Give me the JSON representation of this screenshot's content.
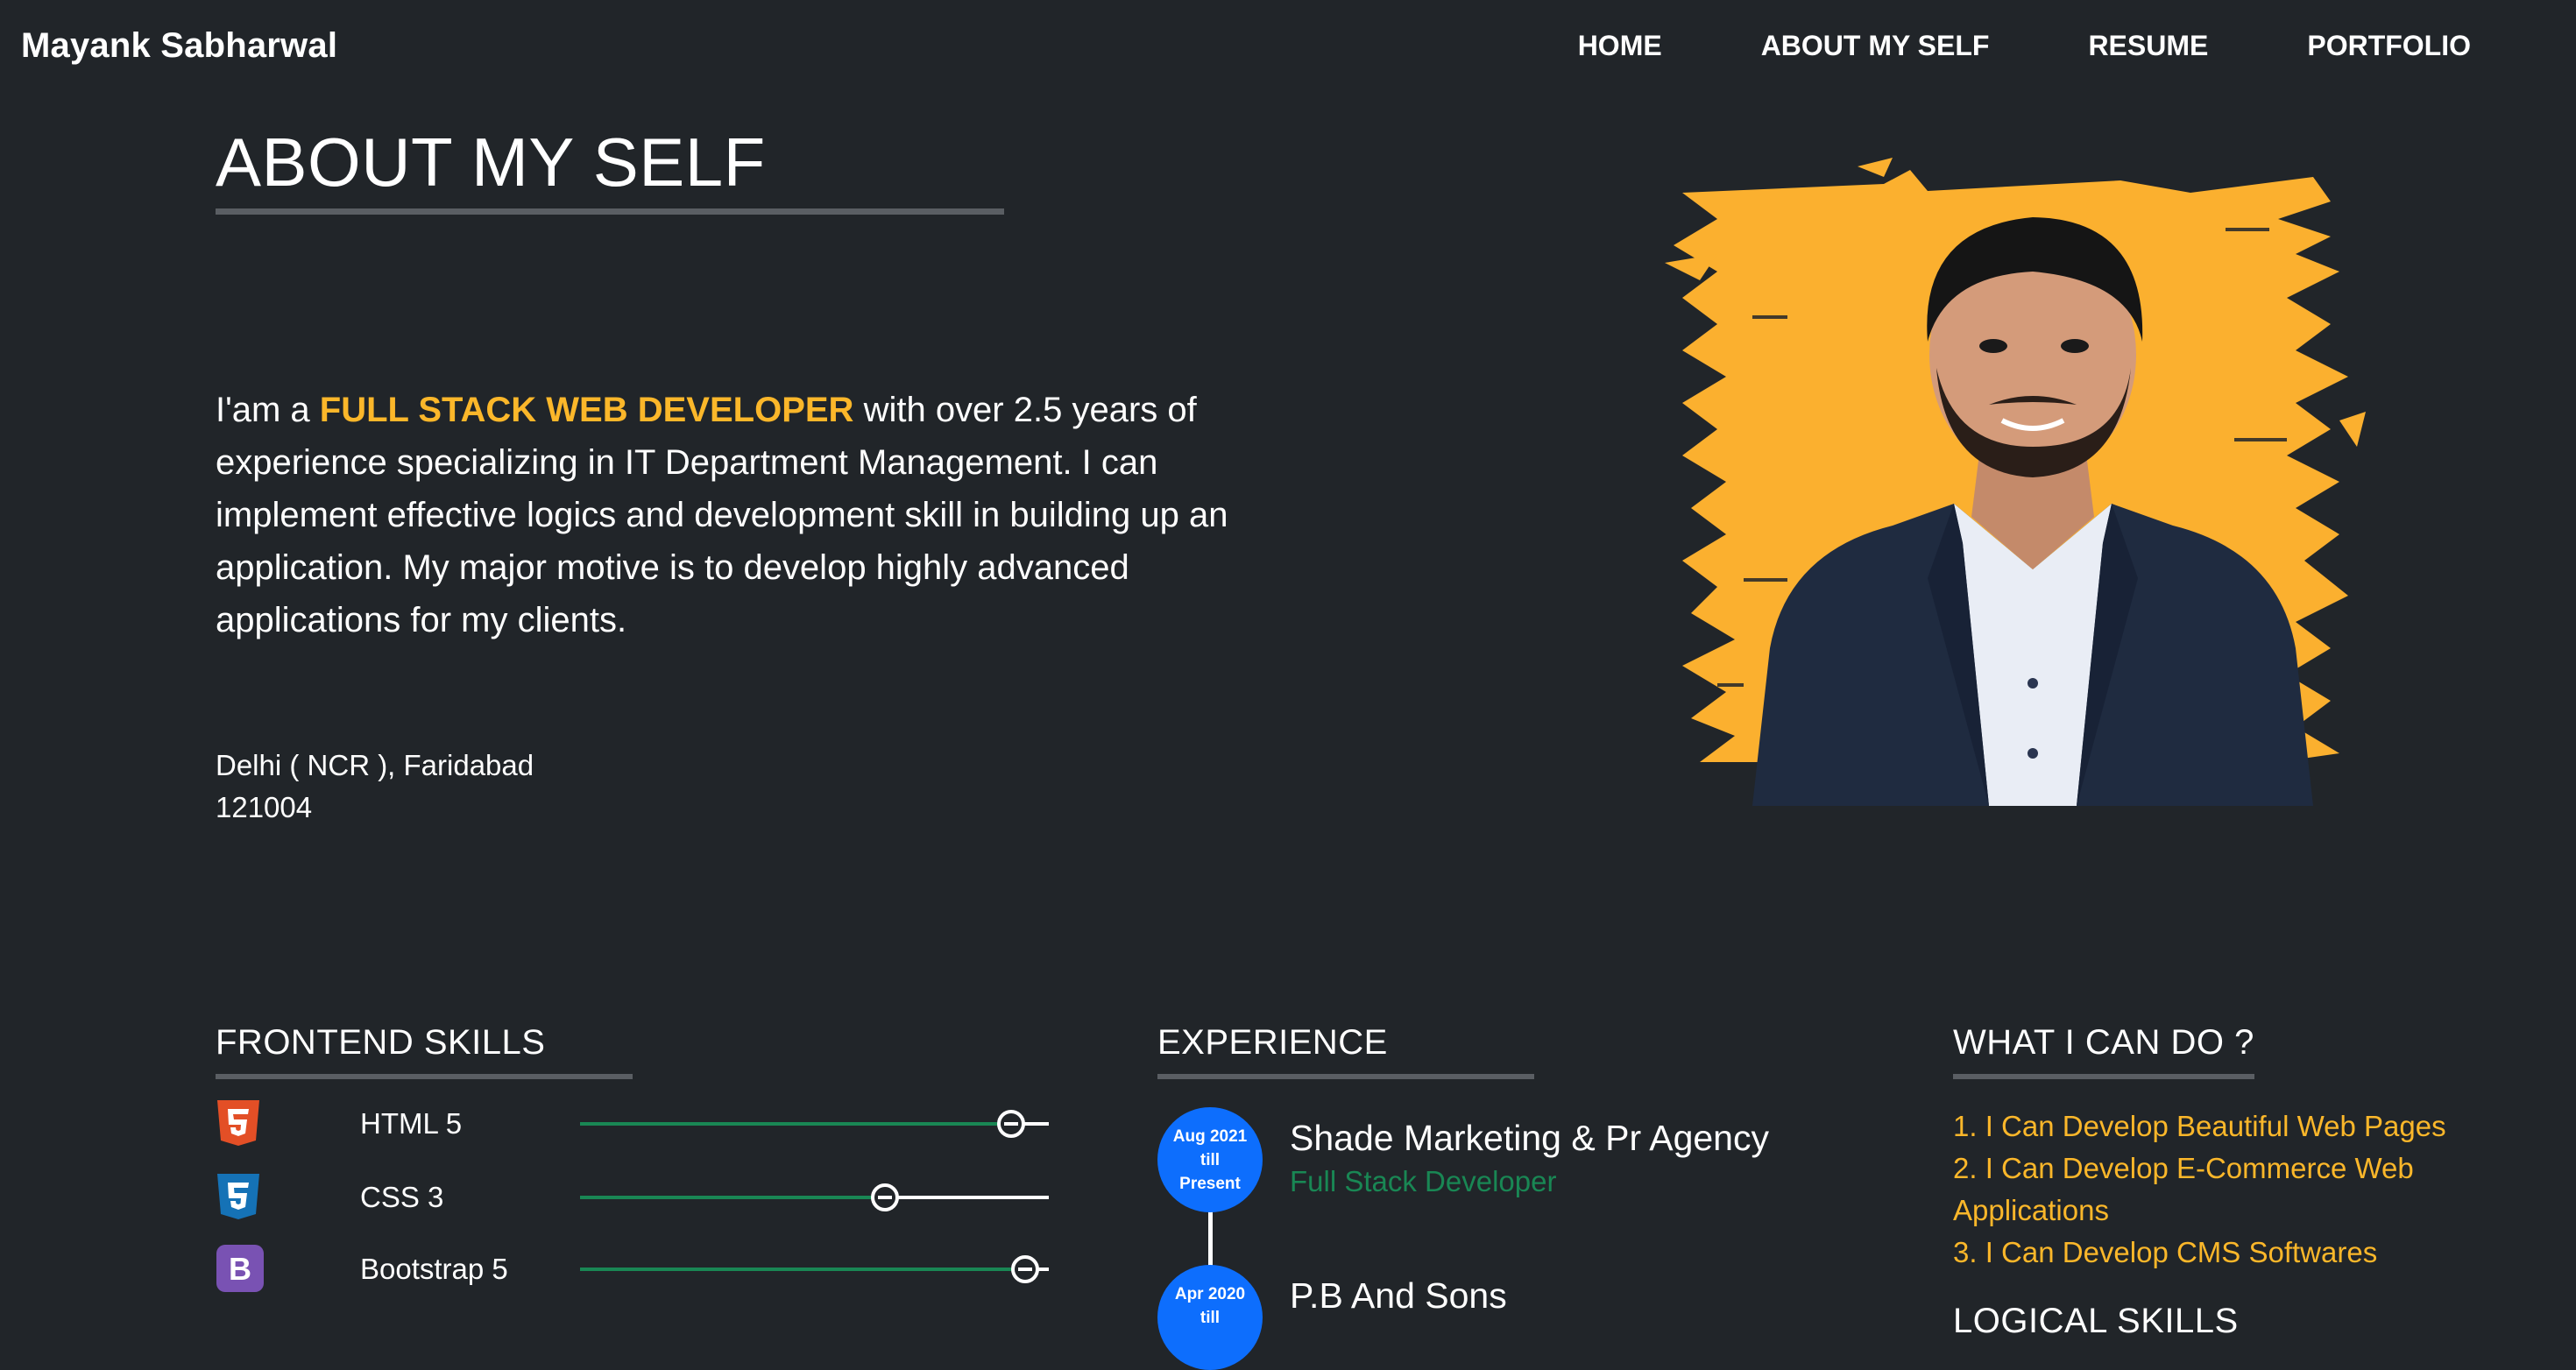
{
  "nav": {
    "brand": "Mayank Sabharwal",
    "links": [
      "HOME",
      "ABOUT MY SELF",
      "RESUME",
      "PORTFOLIO"
    ]
  },
  "about": {
    "title": "ABOUT MY SELF",
    "intro_prefix": "I'am a ",
    "highlight": "FULL STACK WEB DEVELOPER",
    "intro_rest": " with over 2.5 years of experience specializing in IT Department Management. I can implement effective logics and development skill in building up an application. My major motive is to develop highly advanced applications for my clients.",
    "address_line1": "Delhi ( NCR ), Faridabad",
    "address_line2": "121004"
  },
  "skills": {
    "title": "FRONTEND SKILLS",
    "items": [
      {
        "name": "HTML 5",
        "icon": "html5-icon",
        "level": 0.92
      },
      {
        "name": "CSS 3",
        "icon": "css3-icon",
        "level": 0.65
      },
      {
        "name": "Bootstrap 5",
        "icon": "bootstrap-icon",
        "level": 0.95
      }
    ]
  },
  "experience": {
    "title": "EXPERIENCE",
    "items": [
      {
        "period_start": "Aug 2021",
        "period_mid": "till",
        "period_end": "Present",
        "company": "Shade Marketing & Pr Agency",
        "role": "Full Stack Developer"
      },
      {
        "period_start": "Apr 2020",
        "period_mid": "till",
        "period_end": "",
        "company": "P.B And Sons",
        "role": ""
      }
    ]
  },
  "can_do": {
    "title": "WHAT I CAN DO ?",
    "items": [
      "1. I Can Develop Beautiful Web Pages",
      "2. I Can Develop E-Commerce Web Applications",
      "3. I Can Develop CMS Softwares"
    ]
  },
  "logical": {
    "title": "LOGICAL SKILLS"
  },
  "colors": {
    "background": "#212529",
    "accent": "#fbb72a",
    "success": "#198754",
    "primary": "#0d6efd"
  }
}
